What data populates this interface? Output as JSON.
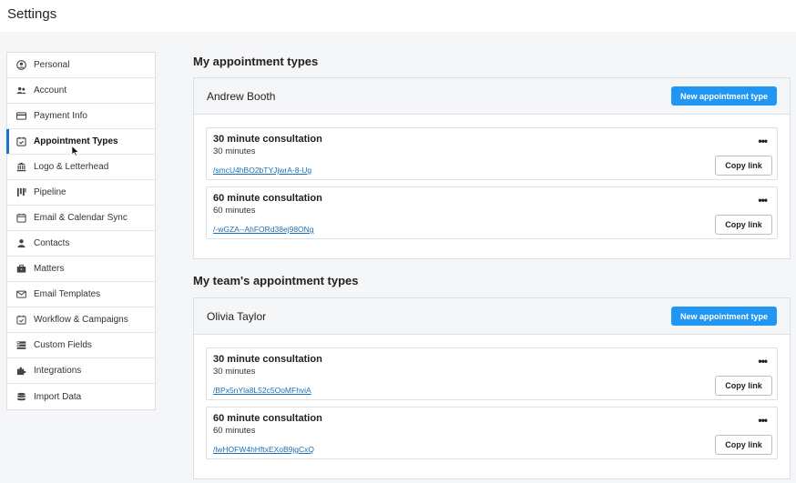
{
  "page": {
    "title": "Settings"
  },
  "sidebar": {
    "items": [
      {
        "label": "Personal",
        "icon": "user-circle-icon"
      },
      {
        "label": "Account",
        "icon": "users-icon"
      },
      {
        "label": "Payment Info",
        "icon": "credit-card-icon"
      },
      {
        "label": "Appointment Types",
        "icon": "calendar-check-icon",
        "active": true
      },
      {
        "label": "Logo & Letterhead",
        "icon": "bank-icon"
      },
      {
        "label": "Pipeline",
        "icon": "columns-icon"
      },
      {
        "label": "Email & Calendar Sync",
        "icon": "calendar-icon"
      },
      {
        "label": "Contacts",
        "icon": "person-icon"
      },
      {
        "label": "Matters",
        "icon": "briefcase-icon"
      },
      {
        "label": "Email Templates",
        "icon": "envelope-icon"
      },
      {
        "label": "Workflow & Campaigns",
        "icon": "calendar-check-icon"
      },
      {
        "label": "Custom Fields",
        "icon": "fields-icon"
      },
      {
        "label": "Integrations",
        "icon": "puzzle-icon"
      },
      {
        "label": "Import Data",
        "icon": "database-icon"
      }
    ]
  },
  "my_types": {
    "section_title": "My appointment types",
    "owner": "Andrew Booth",
    "new_button": "New appointment type",
    "items": [
      {
        "title": "30 minute consultation",
        "duration": "30 minutes",
        "link": "/smcU4hBO2bTYJjwrA-8-Ug",
        "copy_label": "Copy link",
        "more": "•••"
      },
      {
        "title": "60 minute consultation",
        "duration": "60 minutes",
        "link": "/-wGZA--AhFORd38ej98ONg",
        "copy_label": "Copy link",
        "more": "•••"
      }
    ]
  },
  "team_types": {
    "section_title": "My team's appointment types",
    "owner": "Olivia Taylor",
    "new_button": "New appointment type",
    "items": [
      {
        "title": "30 minute consultation",
        "duration": "30 minutes",
        "link": "/BPx5nYla8L52c5OoMFhviA",
        "copy_label": "Copy link",
        "more": "•••"
      },
      {
        "title": "60 minute consultation",
        "duration": "60 minutes",
        "link": "/lwHOFW4hHftxEXoB9jgCxQ",
        "copy_label": "Copy link",
        "more": "•••"
      }
    ]
  },
  "colors": {
    "accent": "#2196f3",
    "active_bar": "#1a73c8",
    "link": "#1a6fb5"
  }
}
